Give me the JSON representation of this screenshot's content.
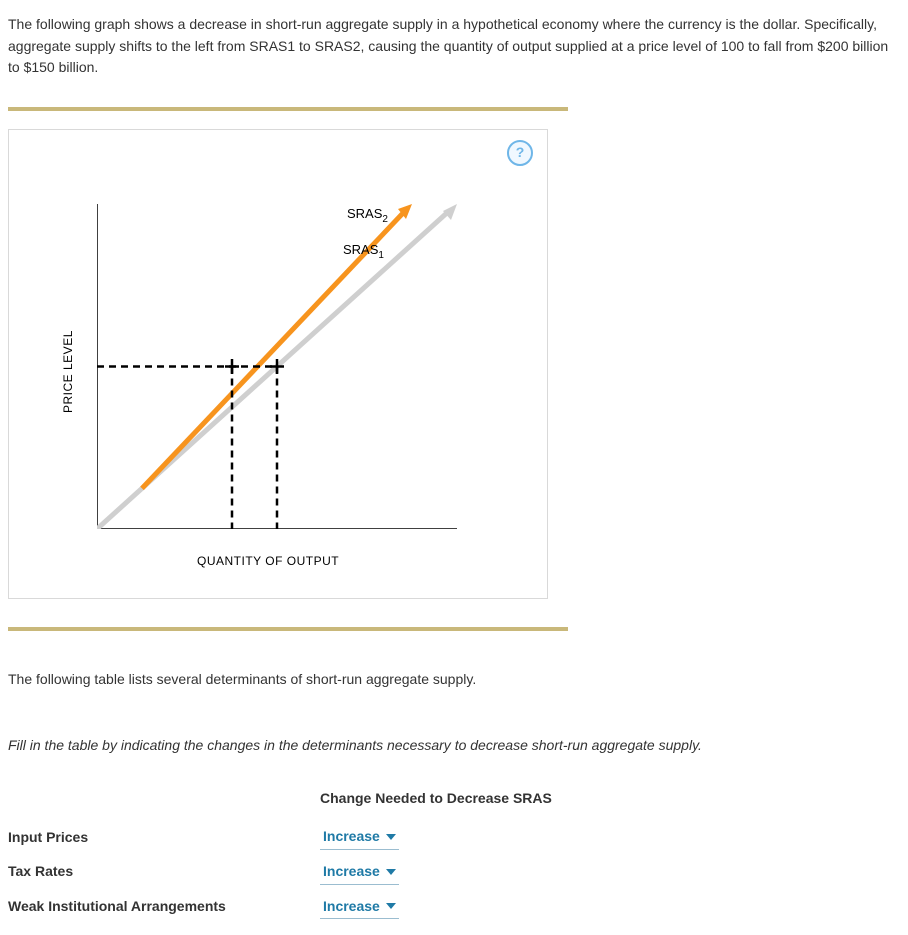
{
  "intro": "The following graph shows a decrease in short-run aggregate supply in a hypothetical economy where the currency is the dollar. Specifically, aggregate supply shifts to the left from SRAS1 to SRAS2, causing the quantity of output supplied at a price level of 100 to fall from $200 billion to $150 billion.",
  "help_icon": "?",
  "chart_data": {
    "type": "line",
    "xlabel": "QUANTITY OF OUTPUT",
    "ylabel": "PRICE LEVEL",
    "xlim": [
      0,
      400
    ],
    "ylim": [
      0,
      200
    ],
    "x_ticks": [
      0,
      50,
      100,
      150,
      200,
      250,
      300,
      350,
      400
    ],
    "y_ticks": [
      0,
      25,
      50,
      75,
      100,
      125,
      150,
      175,
      200
    ],
    "series": [
      {
        "name": "SRAS1",
        "points": [
          [
            0,
            0
          ],
          [
            400,
            200
          ]
        ],
        "color": "#cfcfcf"
      },
      {
        "name": "SRAS2",
        "points": [
          [
            50,
            25
          ],
          [
            350,
            200
          ]
        ],
        "color": "#f7941e"
      }
    ],
    "guides": [
      {
        "type": "h",
        "y": 100,
        "x_from": 0,
        "x_to": 200
      },
      {
        "type": "v",
        "x": 150,
        "y_from": 0,
        "y_to": 100
      },
      {
        "type": "v",
        "x": 200,
        "y_from": 0,
        "y_to": 100
      }
    ],
    "labels": [
      {
        "text": "SRAS",
        "sub": "1",
        "x": 330,
        "y": 165
      },
      {
        "text": "SRAS",
        "sub": "2",
        "x": 330,
        "y": 190
      }
    ]
  },
  "section_text": "The following table lists several determinants of short-run aggregate supply.",
  "instructions": "Fill in the table by indicating the changes in the determinants necessary to decrease short-run aggregate supply.",
  "table": {
    "header": "Change Needed to Decrease SRAS",
    "rows": [
      {
        "label": "Input Prices",
        "value": "Increase"
      },
      {
        "label": "Tax Rates",
        "value": "Increase"
      },
      {
        "label": "Weak Institutional Arrangements",
        "value": "Increase"
      }
    ]
  }
}
